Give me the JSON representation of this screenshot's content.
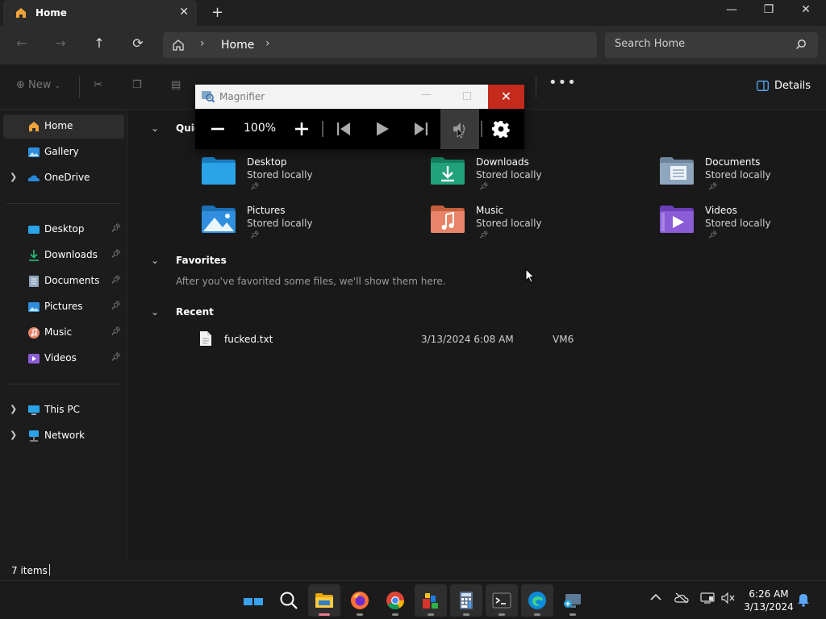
{
  "tab": {
    "title": "Home",
    "close": "✕",
    "new": "+"
  },
  "window_controls": {
    "minimize": "—",
    "maximize": "❐",
    "close": "✕"
  },
  "navigation": {
    "back": "←",
    "forward": "→",
    "up": "↑",
    "refresh": "⟳",
    "breadcrumb": [
      "Home"
    ],
    "search_placeholder": "Search Home"
  },
  "command_bar": {
    "new_label": "New",
    "details_label": "Details"
  },
  "sidebar": {
    "items": [
      {
        "label": "Home",
        "icon": "home-icon",
        "active": true
      },
      {
        "label": "Gallery",
        "icon": "gallery-icon"
      },
      {
        "label": "OneDrive",
        "icon": "cloud-icon",
        "expandable": true
      },
      {
        "label": "Desktop",
        "icon": "desktop-folder-icon",
        "pinned": true
      },
      {
        "label": "Downloads",
        "icon": "downloads-folder-icon",
        "pinned": true
      },
      {
        "label": "Documents",
        "icon": "documents-folder-icon",
        "pinned": true
      },
      {
        "label": "Pictures",
        "icon": "pictures-folder-icon",
        "pinned": true
      },
      {
        "label": "Music",
        "icon": "music-folder-icon",
        "pinned": true
      },
      {
        "label": "Videos",
        "icon": "videos-folder-icon",
        "pinned": true
      },
      {
        "label": "This PC",
        "icon": "pc-icon",
        "expandable": true
      },
      {
        "label": "Network",
        "icon": "network-icon",
        "expandable": true
      }
    ]
  },
  "main": {
    "quick_access": {
      "title": "Quick access",
      "items": [
        {
          "name": "Desktop",
          "sub": "Stored locally",
          "color": "#2aa3e8"
        },
        {
          "name": "Downloads",
          "sub": "Stored locally",
          "color": "#22a27a"
        },
        {
          "name": "Documents",
          "sub": "Stored locally",
          "color": "#8fa6bf"
        },
        {
          "name": "Pictures",
          "sub": "Stored locally",
          "color": "#2f8fde"
        },
        {
          "name": "Music",
          "sub": "Stored locally",
          "color": "#e8846a"
        },
        {
          "name": "Videos",
          "sub": "Stored locally",
          "color": "#8b5cd6"
        }
      ]
    },
    "favorites": {
      "title": "Favorites",
      "empty_text": "After you've favorited some files, we'll show them here."
    },
    "recent": {
      "title": "Recent",
      "rows": [
        {
          "name": "fucked.txt",
          "date": "3/13/2024 6:08 AM",
          "location": "VM6"
        }
      ]
    }
  },
  "status_bar": {
    "text": "7 items"
  },
  "magnifier": {
    "title": "Magnifier",
    "zoom": "100%",
    "close": "✕"
  },
  "taskbar": {
    "apps": [
      "start",
      "search",
      "file-explorer",
      "firefox",
      "chrome",
      "app-5",
      "calculator",
      "terminal",
      "edge",
      "rdp"
    ],
    "clock_time": "6:26 AM",
    "clock_date": "3/13/2024"
  }
}
